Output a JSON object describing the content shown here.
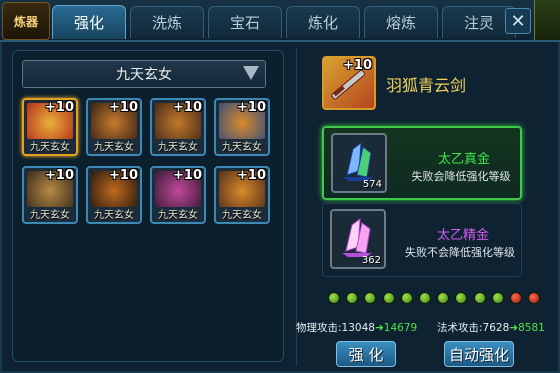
{
  "logo": {
    "text": "炼器"
  },
  "tabs": [
    {
      "label": "强化",
      "active": true
    },
    {
      "label": "洗炼",
      "active": false
    },
    {
      "label": "宝石",
      "active": false
    },
    {
      "label": "炼化",
      "active": false
    },
    {
      "label": "熔炼",
      "active": false
    },
    {
      "label": "注灵",
      "active": false
    }
  ],
  "close_label": "✕",
  "dropdown": {
    "selected": "九天玄女"
  },
  "items": [
    {
      "plus": "+10",
      "name": "九天玄女",
      "icon": "sword-icon",
      "colors": [
        "#e9b23a",
        "#b6301c"
      ],
      "selected": true
    },
    {
      "plus": "+10",
      "name": "九天玄女",
      "icon": "armor-icon",
      "colors": [
        "#c77a2b",
        "#3a2418"
      ],
      "selected": false
    },
    {
      "plus": "+10",
      "name": "九天玄女",
      "icon": "helmet-icon",
      "colors": [
        "#c07a2a",
        "#4b2a1a"
      ],
      "selected": false
    },
    {
      "plus": "+10",
      "name": "九天玄女",
      "icon": "shield-icon",
      "colors": [
        "#d98a2a",
        "#3b4f7a"
      ],
      "selected": false
    },
    {
      "plus": "+10",
      "name": "九天玄女",
      "icon": "chest-armor-icon",
      "colors": [
        "#b78a45",
        "#3a2c1c"
      ],
      "selected": false
    },
    {
      "plus": "+10",
      "name": "九天玄女",
      "icon": "leggings-icon",
      "colors": [
        "#c06a1e",
        "#2a1a10"
      ],
      "selected": false
    },
    {
      "plus": "+10",
      "name": "九天玄女",
      "icon": "necklace-icon",
      "colors": [
        "#c14a9a",
        "#3a1a36"
      ],
      "selected": false
    },
    {
      "plus": "+10",
      "name": "九天玄女",
      "icon": "bracer-icon",
      "colors": [
        "#d88a2a",
        "#56301a"
      ],
      "selected": false
    }
  ],
  "target": {
    "plus": "+10",
    "name": "羽狐青云剑",
    "icon": "sword-icon"
  },
  "materials": [
    {
      "name": "太乙真金",
      "count": "574",
      "desc": "失败会降低强化等级",
      "name_color": "#3ee84a",
      "icon": "blue-crystal-icon",
      "selected": true
    },
    {
      "name": "太乙精金",
      "count": "362",
      "desc": "失败不会降低强化等级",
      "name_color": "#d35cf0",
      "icon": "pink-crystal-icon",
      "selected": false
    }
  ],
  "level_dots": [
    "g",
    "g",
    "g",
    "g",
    "g",
    "g",
    "g",
    "g",
    "g",
    "g",
    "r",
    "r"
  ],
  "stats": {
    "physical_label": "物理攻击:",
    "physical_old": "13048",
    "physical_new": "14679",
    "magic_label": "法术攻击:",
    "magic_old": "7628",
    "magic_new": "8581",
    "arrow": "➜"
  },
  "buttons": {
    "enhance": "强 化",
    "auto_enhance": "自动强化"
  }
}
